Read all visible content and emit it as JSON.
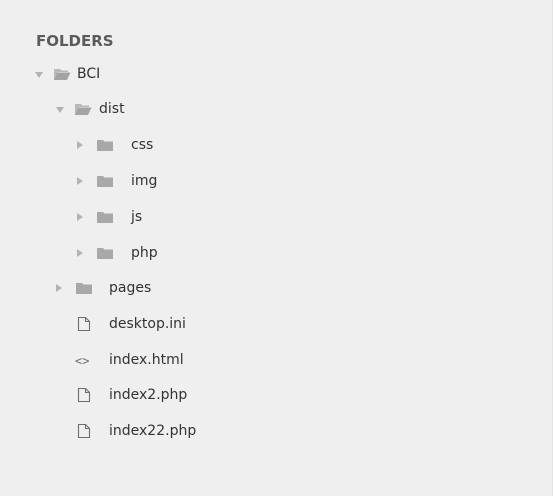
{
  "sidebar": {
    "header": "FOLDERS",
    "tree": {
      "root": {
        "name": "BCI",
        "state": "expanded",
        "icon": "folder-open-icon"
      },
      "dist": {
        "name": "dist",
        "state": "expanded",
        "icon": "folder-open-icon"
      },
      "css": {
        "name": "css",
        "state": "collapsed",
        "icon": "folder-icon"
      },
      "img": {
        "name": "img",
        "state": "collapsed",
        "icon": "folder-icon"
      },
      "js": {
        "name": "js",
        "state": "collapsed",
        "icon": "folder-icon"
      },
      "php": {
        "name": "php",
        "state": "collapsed",
        "icon": "folder-icon"
      },
      "pages": {
        "name": "pages",
        "state": "collapsed",
        "icon": "folder-icon"
      },
      "desktop_ini": {
        "name": "desktop.ini",
        "icon": "file-icon"
      },
      "index_html": {
        "name": "index.html",
        "icon": "code-file-icon"
      },
      "index2_php": {
        "name": "index2.php",
        "icon": "file-icon"
      },
      "index22_php": {
        "name": "index22.php",
        "icon": "file-icon"
      }
    }
  },
  "colors": {
    "sidebar_bg": "#efefef",
    "text": "#333333",
    "header_text": "#5b5b5b",
    "icon_gray": "#aaaaaa",
    "arrow_gray": "#b3b3b3"
  }
}
